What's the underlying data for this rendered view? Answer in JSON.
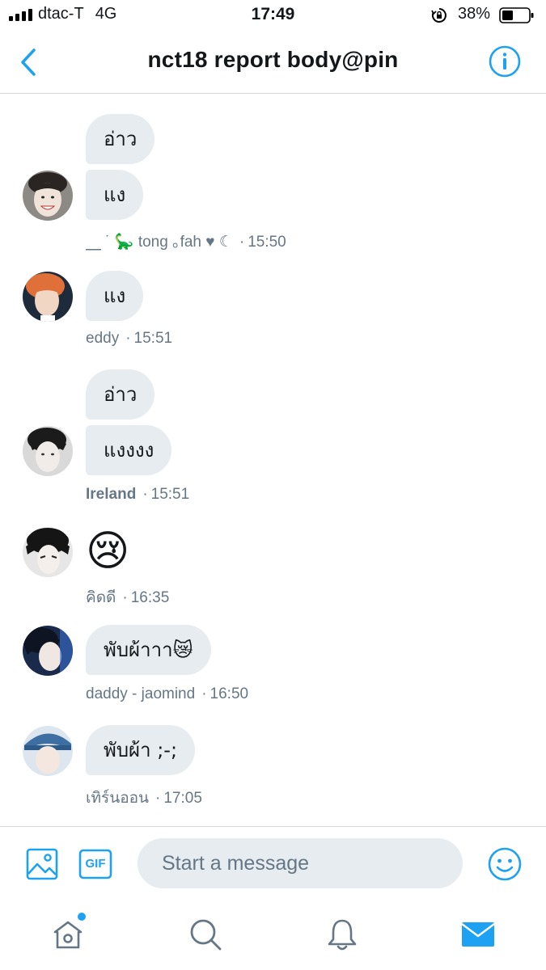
{
  "status_bar": {
    "carrier": "dtac-T",
    "network": "4G",
    "time": "17:49",
    "battery_percent": "38%",
    "icons": [
      "signal-bars-icon",
      "rotation-lock-icon",
      "battery-icon"
    ]
  },
  "header": {
    "title": "nct18 report body@pin",
    "back_icon": "chevron-left-icon",
    "info_icon": "info-icon"
  },
  "messages": [
    {
      "bubbles": [
        "อ่าว",
        "แง"
      ],
      "sender": "⎽ ˙ 🦕 tong ｡fah ♥ ☾",
      "time": "15:50"
    },
    {
      "bubbles": [
        "แง"
      ],
      "sender": "eddy",
      "time": "15:51"
    },
    {
      "bubbles": [
        "อ่าว",
        "แงงงง"
      ],
      "sender": "Ireland",
      "time": "15:51"
    },
    {
      "bubbles": [
        "😢"
      ],
      "sender": "คิดดี",
      "time": "16:35"
    },
    {
      "bubbles": [
        "พับผ้าาา😿"
      ],
      "sender": "daddy - jaomind",
      "time": "16:50"
    },
    {
      "bubbles": [
        "พับผ้า ;-;"
      ],
      "sender": "เทิร์นออน",
      "time": "17:05"
    }
  ],
  "composer": {
    "placeholder": "Start a message",
    "image_icon": "image-icon",
    "gif_label": "GIF",
    "emoji_icon": "smiley-icon"
  },
  "tabbar": {
    "items": [
      "home-icon",
      "search-icon",
      "bell-icon",
      "mail-icon"
    ],
    "active": "mail-icon",
    "home_has_unread_dot": true
  },
  "colors": {
    "accent": "#1da1f2",
    "bubble": "#e6ecf0",
    "meta_text": "#657786",
    "primary_text": "#14171a"
  }
}
